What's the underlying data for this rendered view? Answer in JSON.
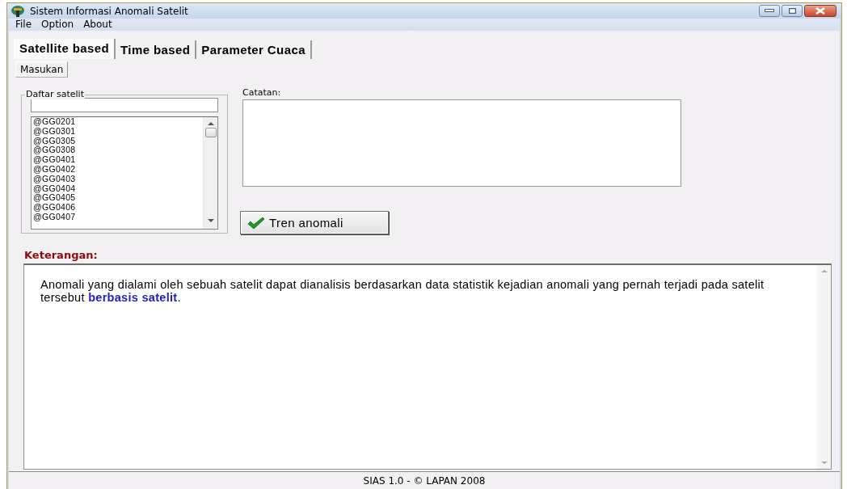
{
  "window": {
    "title": "Sistem Informasi Anomali Satelit"
  },
  "menu": [
    "File",
    "Option",
    "About"
  ],
  "tabs": [
    {
      "label": "Satellite based",
      "selected": true
    },
    {
      "label": "Time based",
      "selected": false
    },
    {
      "label": "Parameter Cuaca",
      "selected": false
    }
  ],
  "subtabs": [
    {
      "label": "Masukan",
      "selected": true
    }
  ],
  "satellite_group": {
    "title": "Daftar satelit",
    "items": [
      "@GG0201",
      "@GG0301",
      "@GG0305",
      "@GG0308",
      "@GG0401",
      "@GG0402",
      "@GG0403",
      "@GG0404",
      "@GG0405",
      "@GG0406",
      "@GG0407"
    ]
  },
  "notes": {
    "label": "Catatan:"
  },
  "trend_button": {
    "label": "Tren anomali"
  },
  "description": {
    "label": "Keterangan:",
    "text": "Anomali yang dialami oleh sebuah satelit dapat dianalisis berdasarkan data statistik kejadian anomali yang pernah terjadi pada satelit tersebut **berbasis satelit**."
  },
  "status_bar": "SIAS 1.0 - © LAPAN 2008"
}
